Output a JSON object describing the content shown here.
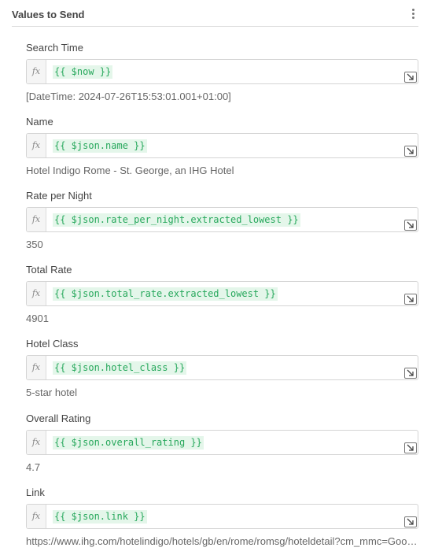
{
  "header": {
    "title": "Values to Send",
    "menu_icon": "kebab-menu-icon"
  },
  "fields": [
    {
      "label": "Search Time",
      "expression": "{{ $now }}",
      "result": "[DateTime: 2024-07-26T15:53:01.001+01:00]"
    },
    {
      "label": "Name",
      "expression": "{{ $json.name }}",
      "result": "Hotel Indigo Rome - St. George, an IHG Hotel"
    },
    {
      "label": "Rate per Night",
      "expression": "{{ $json.rate_per_night.extracted_lowest }}",
      "result": "350"
    },
    {
      "label": "Total Rate",
      "expression": "{{ $json.total_rate.extracted_lowest }}",
      "result": "4901"
    },
    {
      "label": "Hotel Class",
      "expression": "{{ $json.hotel_class }}",
      "result": "5-star hotel"
    },
    {
      "label": "Overall Rating",
      "expression": "{{ $json.overall_rating }}",
      "result": "4.7"
    },
    {
      "label": "Link",
      "expression": "{{ $json.link }}",
      "result": "https://www.ihg.com/hotelindigo/hotels/gb/en/rome/romsg/hoteldetail?cm_mmc=GoogleMaps-_-IN-_-IT-_-ROMSG"
    }
  ],
  "fx_symbol": "fx",
  "icons": {
    "fx": "function-icon",
    "expand": "expand-icon"
  },
  "colors": {
    "expression_text": "#27a85c",
    "expression_bg": "#e4f6ea"
  }
}
